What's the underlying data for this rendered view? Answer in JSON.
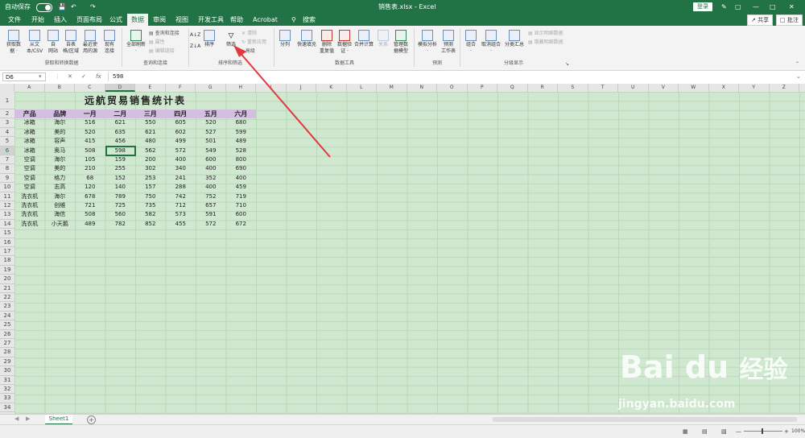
{
  "titlebar": {
    "autosave": "自动保存",
    "filename": "销售表.xlsx - Excel",
    "login": "登录"
  },
  "menu": {
    "items": [
      "文件",
      "开始",
      "插入",
      "页面布局",
      "公式",
      "数据",
      "审阅",
      "视图",
      "开发工具",
      "帮助",
      "Acrobat"
    ],
    "active": "数据",
    "search": "搜索",
    "share": "共享",
    "comment": "批注"
  },
  "ribbon": {
    "big_buttons": [
      {
        "label": "获取数\n据 ·",
        "icon": "database-icon"
      },
      {
        "label": "从文\n本/CSV",
        "icon": "text-file-icon"
      },
      {
        "label": "自\n网站",
        "icon": "web-icon"
      },
      {
        "label": "自表\n格/区域",
        "icon": "table-icon"
      },
      {
        "label": "最近使\n用的源",
        "icon": "recent-source-icon"
      },
      {
        "label": "现有\n连接",
        "icon": "connection-icon"
      },
      {
        "label": "全部刷新\n·",
        "icon": "refresh-icon"
      },
      {
        "label": "排序",
        "icon": "sort-icon"
      },
      {
        "label": "筛选",
        "icon": "filter-icon"
      },
      {
        "label": "分列",
        "icon": "split-column-icon"
      },
      {
        "label": "快速填充",
        "icon": "flash-fill-icon"
      },
      {
        "label": "删除\n重复值",
        "icon": "remove-duplicates-icon"
      },
      {
        "label": "数据验\n证 ·",
        "icon": "data-validation-icon"
      },
      {
        "label": "合并计算",
        "icon": "consolidate-icon"
      },
      {
        "label": "关系",
        "icon": "relationship-icon"
      },
      {
        "label": "管理数\n据模型",
        "icon": "data-model-icon"
      },
      {
        "label": "模拟分析\n·",
        "icon": "what-if-icon"
      },
      {
        "label": "预测\n工作表",
        "icon": "forecast-icon"
      },
      {
        "label": "组合\n·",
        "icon": "group-icon"
      },
      {
        "label": "取消组合\n·",
        "icon": "ungroup-icon"
      },
      {
        "label": "分类汇总",
        "icon": "subtotal-icon"
      }
    ],
    "small_buttons": {
      "queries": "查询和连接",
      "properties": "属性",
      "edit_links": "编辑链接",
      "clear": "清除",
      "reapply": "重新应用",
      "advanced": "高级",
      "show_detail": "显示明细数据",
      "hide_detail": "隐藏明细数据"
    },
    "groups": [
      "获取和转换数据",
      "查询和连接",
      "排序和筛选",
      "数据工具",
      "预测",
      "分级显示"
    ]
  },
  "formula_bar": {
    "name_box": "D6",
    "fx": "fx",
    "value": "598"
  },
  "grid": {
    "columns": [
      "A",
      "B",
      "C",
      "D",
      "E",
      "F",
      "G",
      "H",
      "I",
      "J",
      "K",
      "L",
      "M",
      "N",
      "O",
      "P",
      "Q",
      "R",
      "S",
      "T",
      "U",
      "V",
      "W",
      "X",
      "Y",
      "Z"
    ],
    "row_count": 38,
    "selected_column": "D",
    "selected_row": "6"
  },
  "table": {
    "title": "远航贸易销售统计表",
    "headers": [
      "产品",
      "品牌",
      "一月",
      "二月",
      "三月",
      "四月",
      "五月",
      "六月"
    ],
    "rows": [
      [
        "冰箱",
        "海尔",
        "516",
        "621",
        "550",
        "605",
        "520",
        "680"
      ],
      [
        "冰箱",
        "美的",
        "520",
        "635",
        "621",
        "602",
        "527",
        "599"
      ],
      [
        "冰箱",
        "容声",
        "415",
        "456",
        "480",
        "499",
        "501",
        "489"
      ],
      [
        "冰箱",
        "奥马",
        "508",
        "598",
        "562",
        "572",
        "549",
        "528"
      ],
      [
        "空调",
        "海尔",
        "105",
        "159",
        "200",
        "400",
        "600",
        "800"
      ],
      [
        "空调",
        "美的",
        "210",
        "255",
        "302",
        "340",
        "400",
        "690"
      ],
      [
        "空调",
        "格力",
        "68",
        "152",
        "253",
        "241",
        "352",
        "400"
      ],
      [
        "空调",
        "志高",
        "120",
        "140",
        "157",
        "288",
        "400",
        "459"
      ],
      [
        "洗衣机",
        "海尔",
        "678",
        "789",
        "750",
        "742",
        "752",
        "719"
      ],
      [
        "洗衣机",
        "创维",
        "721",
        "725",
        "735",
        "712",
        "657",
        "710"
      ],
      [
        "洗衣机",
        "海信",
        "508",
        "560",
        "582",
        "573",
        "591",
        "600"
      ],
      [
        "洗衣机",
        "小天鹅",
        "489",
        "782",
        "852",
        "455",
        "572",
        "672"
      ]
    ]
  },
  "tabs": {
    "sheet": "Sheet1"
  },
  "status": {
    "zoom": "100%"
  },
  "watermark": {
    "brand": "Bai du",
    "cn": "经验",
    "url": "jingyan.baidu.com"
  },
  "colors": {
    "excel_green": "#217346",
    "grid_bg": "#cfe8cf",
    "header_purple": "#d5bfe0",
    "arrow_red": "#e0393e"
  }
}
